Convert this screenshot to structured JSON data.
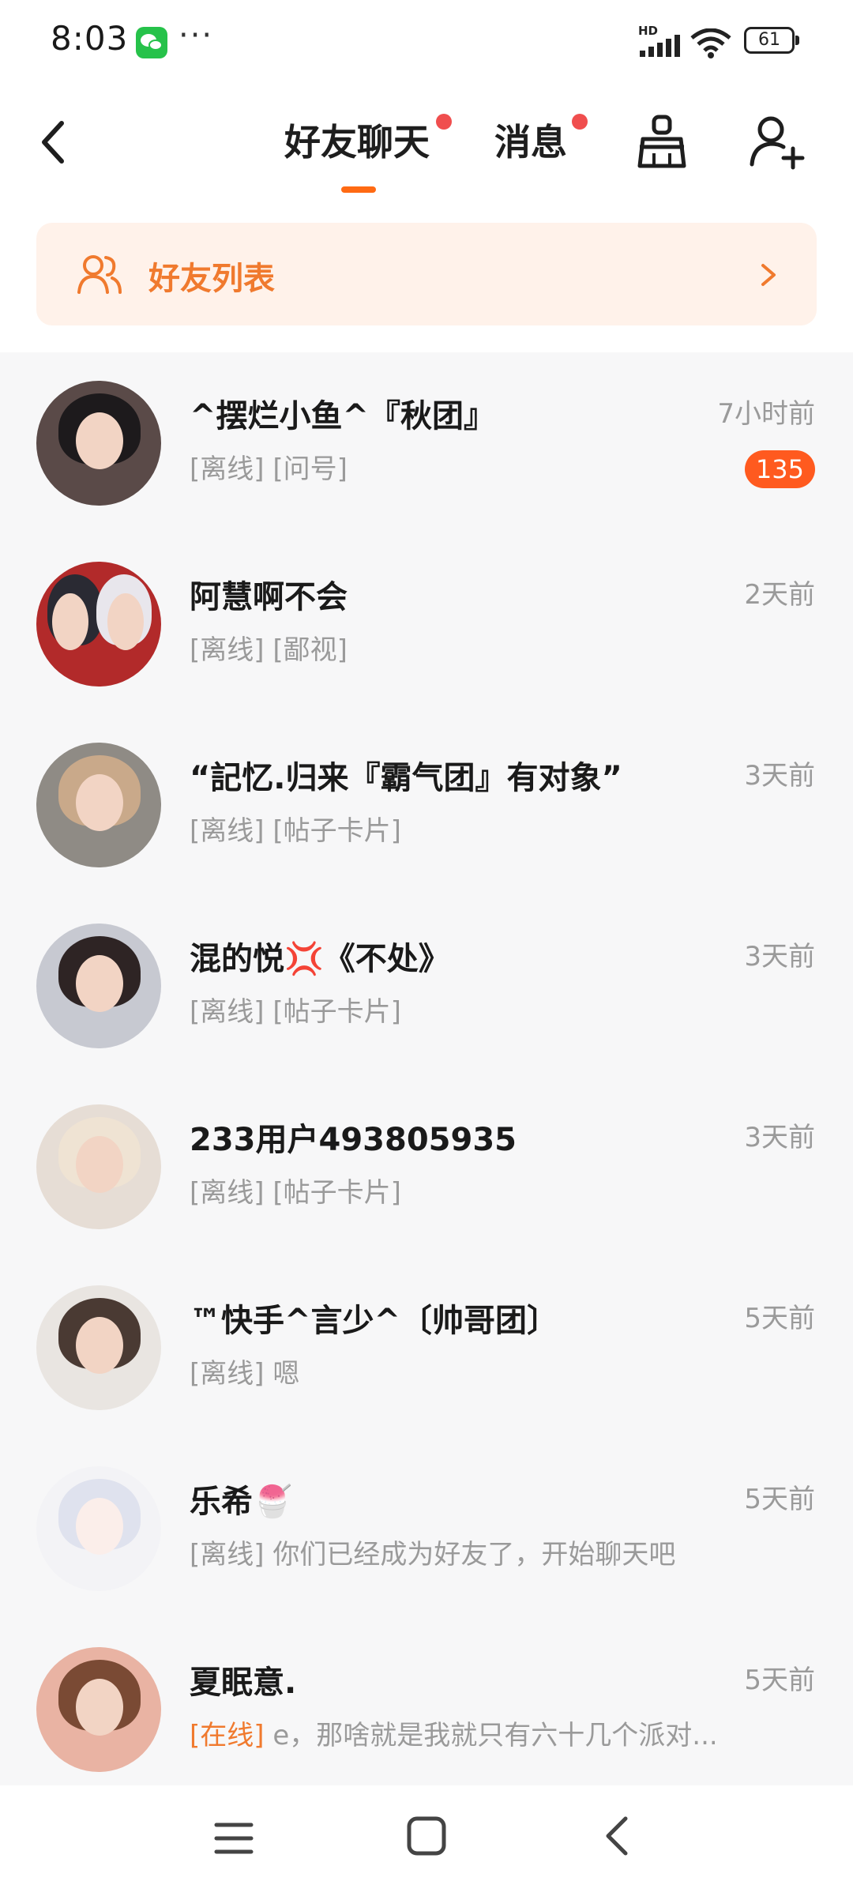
{
  "status_bar": {
    "time": "8:03",
    "more": "···",
    "network": "HD",
    "battery": "61"
  },
  "header": {
    "tabs": [
      {
        "label": "好友聊天",
        "active": true,
        "has_dot": true
      },
      {
        "label": "消息",
        "active": false,
        "has_dot": true
      }
    ],
    "icons": [
      "back-icon",
      "broom-icon",
      "add-friend-icon"
    ]
  },
  "banner": {
    "label": "好友列表",
    "icon": "friends-icon",
    "arrow": "chevron-right-icon"
  },
  "colors": {
    "accent": "#ff6a13",
    "banner_bg": "#fff2ea",
    "banner_text": "#f07a2e",
    "badge": "#ff5a1f",
    "dot": "#f04e4e"
  },
  "chats": [
    {
      "name": "^摆烂小鱼^『秋团』",
      "time": "7小时前",
      "status": "[离线]",
      "preview": " [问号]",
      "badge": "135"
    },
    {
      "name": "阿慧啊不会",
      "time": "2天前",
      "status": "[离线]",
      "preview": " [鄙视]",
      "badge": ""
    },
    {
      "name": "“記忆.归来『霸气团』有对象”",
      "time": "3天前",
      "status": "[离线]",
      "preview": " [帖子卡片]",
      "badge": ""
    },
    {
      "name": "混的悦💢《不处》",
      "time": "3天前",
      "status": "[离线]",
      "preview": " [帖子卡片]",
      "badge": ""
    },
    {
      "name": "233用户493805935",
      "time": "3天前",
      "status": "[离线]",
      "preview": " [帖子卡片]",
      "badge": ""
    },
    {
      "name": "™快手^言少^〔帅哥团〕",
      "time": "5天前",
      "status": "[离线]",
      "preview": " 嗯",
      "badge": ""
    },
    {
      "name": "乐希🍧",
      "time": "5天前",
      "status": "[离线]",
      "preview": " 你们已经成为好友了，开始聊天吧",
      "badge": ""
    },
    {
      "name": "夏眠意.",
      "time": "5天前",
      "status": "[在线]",
      "preview": " e，那啥就是我就只有六十几个派对...",
      "badge": ""
    }
  ],
  "nav_bar": {
    "icons": [
      "menu-icon",
      "home-icon",
      "back-icon"
    ]
  }
}
